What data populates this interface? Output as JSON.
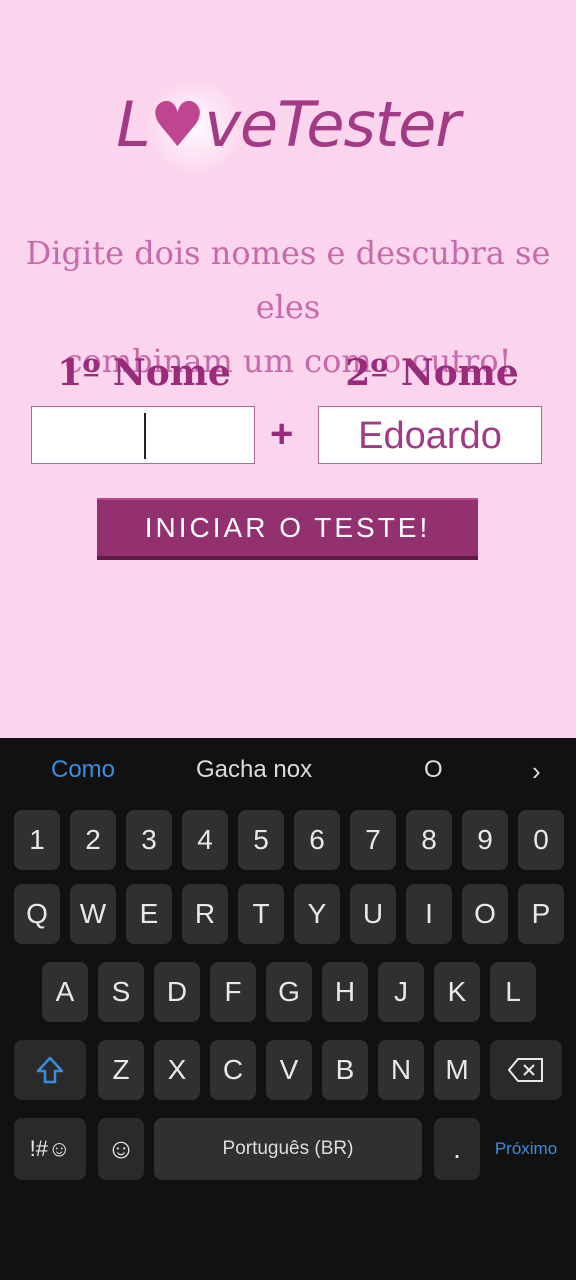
{
  "app": {
    "logo": {
      "love_prefix": "L",
      "heart": "♥",
      "love_suffix": "ve",
      "tester": "Tester"
    },
    "subtitle_line1": "Digite dois nomes e descubra se eles",
    "subtitle_line2": "combinam um com o outro!",
    "name1_label": "1º Nome",
    "name2_label": "2º Nome",
    "name1_value": "",
    "name2_value": "Edoardo",
    "plus": "+",
    "start_button": "INICIAR O TESTE!"
  },
  "keyboard": {
    "suggestions": [
      "Como",
      "Gacha nox",
      "O"
    ],
    "suggestion_arrow": "›",
    "row_numbers": [
      "1",
      "2",
      "3",
      "4",
      "5",
      "6",
      "7",
      "8",
      "9",
      "0"
    ],
    "row_q": [
      "Q",
      "W",
      "E",
      "R",
      "T",
      "Y",
      "U",
      "I",
      "O",
      "P"
    ],
    "row_a": [
      "A",
      "S",
      "D",
      "F",
      "G",
      "H",
      "J",
      "K",
      "L"
    ],
    "row_z": [
      "Z",
      "X",
      "C",
      "V",
      "B",
      "N",
      "M"
    ],
    "symbols_key": "!#☺",
    "emoji_key": "☺",
    "space_label": "Português (BR)",
    "period_key": ".",
    "next_key": "Próximo",
    "shift_icon": "shift-icon",
    "backspace_icon": "backspace-icon",
    "accent_color": "#3b8de0"
  }
}
